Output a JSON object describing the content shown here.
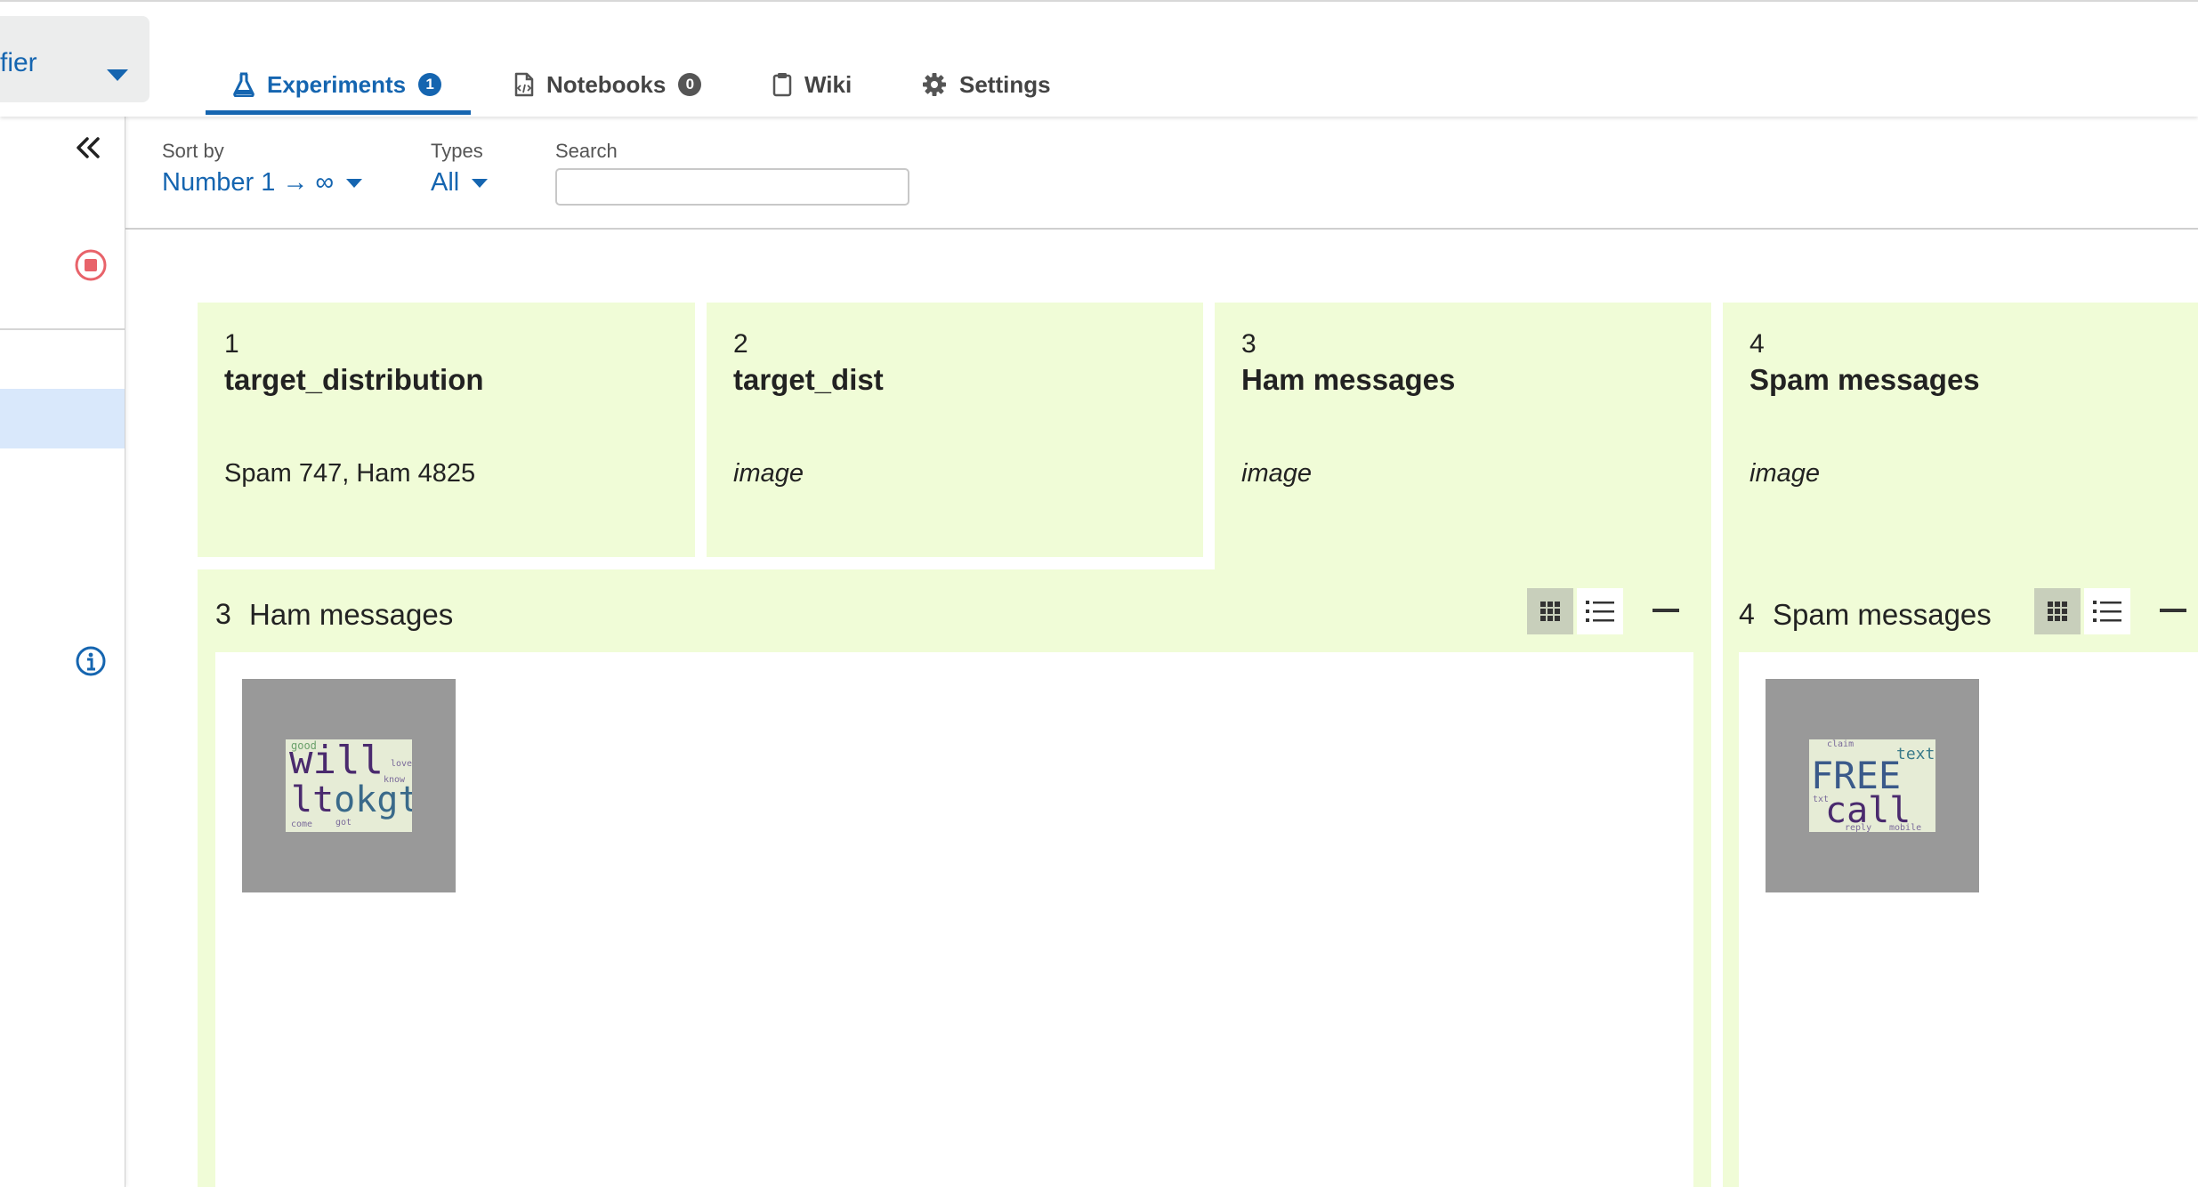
{
  "project": {
    "name": "fier"
  },
  "tabs": [
    {
      "label": "Experiments",
      "badge": "1",
      "icon": "flask-icon",
      "active": true
    },
    {
      "label": "Notebooks",
      "badge": "0",
      "icon": "notebook-icon",
      "active": false
    },
    {
      "label": "Wiki",
      "icon": "clipboard-icon",
      "active": false
    },
    {
      "label": "Settings",
      "icon": "gear-icon",
      "active": false
    }
  ],
  "sidebar": {
    "icons": [
      "double-chevron-left-icon",
      "stop-circle-icon",
      "info-icon"
    ]
  },
  "filters": {
    "sort_label": "Sort by",
    "sort_value": "Number 1 → ∞",
    "types_label": "Types",
    "types_value": "All",
    "search_label": "Search",
    "search_value": ""
  },
  "cards": [
    {
      "number": "1",
      "title": "target_distribution",
      "value": "Spam 747, Ham 4825"
    },
    {
      "number": "2",
      "title": "target_dist",
      "value": "image"
    },
    {
      "number": "3",
      "title": "Ham messages",
      "value": "image"
    },
    {
      "number": "4",
      "title": "Spam messages",
      "value": "image"
    }
  ],
  "panels": [
    {
      "number": "3",
      "title": "Ham messages",
      "wordcloud": {
        "line1": "will",
        "line2a": "lt",
        "line2b": "okgt",
        "small1": "love",
        "small2": "come",
        "small3": "got",
        "small4": "good",
        "small5": "know"
      }
    },
    {
      "number": "4",
      "title": "Spam messages",
      "wordcloud": {
        "line1": "FREE",
        "line2a": "",
        "line2b": "call",
        "small1": "text",
        "small2": "txt",
        "small3": "mobile",
        "small4": "claim",
        "small5": "reply"
      }
    }
  ],
  "colors": {
    "accent": "#1565b0",
    "card_background": "#f0fcd7",
    "selected_sidebar": "#d9e8fb",
    "stop_icon": "#e8636a",
    "thumbnail_frame": "#999999"
  }
}
